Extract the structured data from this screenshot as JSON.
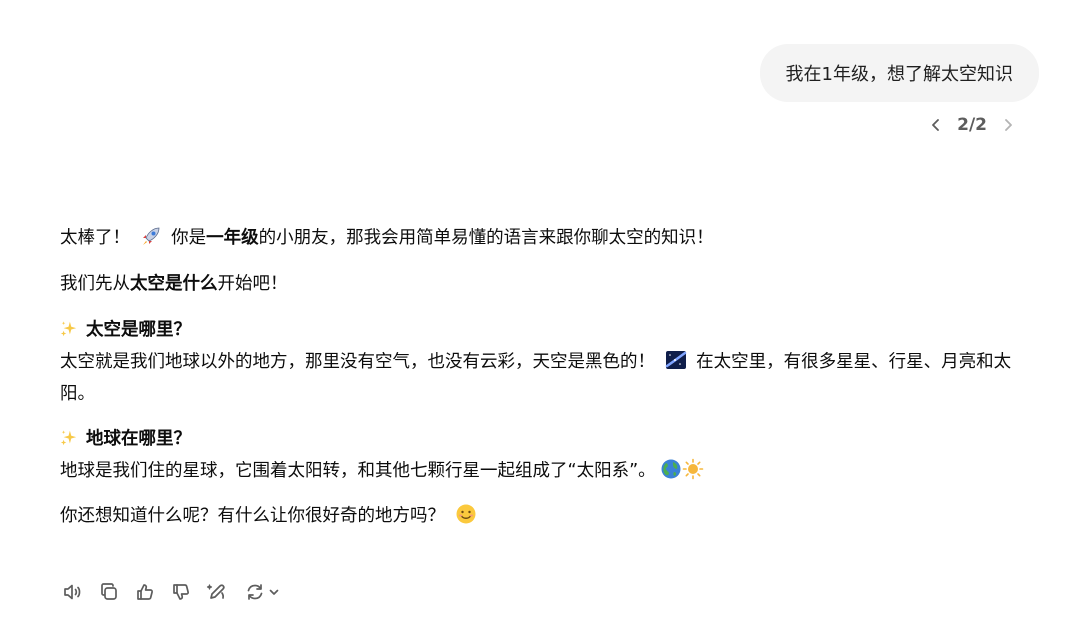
{
  "user_message": {
    "text": "我在1年级，想了解太空知识"
  },
  "pager": {
    "label": "2/2"
  },
  "assistant": {
    "p1_a": "太棒了！",
    "p1_b": " 你是",
    "p1_bold": "一年级",
    "p1_c": "的小朋友，那我会用简单易懂的语言来跟你聊太空的知识！",
    "p2_a": "我们先从",
    "p2_bold": "太空是什么",
    "p2_b": "开始吧！",
    "s1_title": "太空是哪里？",
    "s1_text_a": "太空就是我们地球以外的地方，那里没有空气，也没有云彩，天空是黑色的！",
    "s1_text_b": " 在太空里，有很多星星、行星、月亮和太阳。",
    "s2_title": "地球在哪里？",
    "s2_text": "地球是我们住的星球，它围着太阳转，和其他七颗行星一起组成了“太阳系”。",
    "p_last": "你还想知道什么呢？有什么让你很好奇的地方吗？"
  },
  "icons": {
    "rocket": "rocket-emoji",
    "sparkles": "sparkles-emoji",
    "milky_way": "milky-way-emoji",
    "earth": "earth-globe-emoji",
    "sun": "sun-emoji",
    "smile": "smiling-face-emoji"
  },
  "actions": [
    "read-aloud",
    "copy",
    "thumbs-up",
    "thumbs-down",
    "edit-canvas",
    "regenerate"
  ]
}
